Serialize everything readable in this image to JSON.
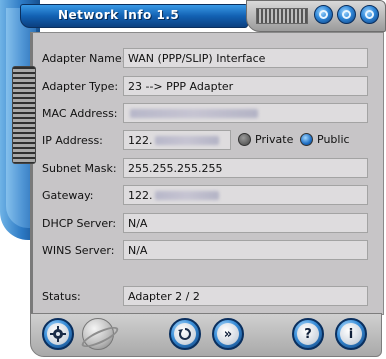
{
  "window": {
    "title": "Network Info 1.5"
  },
  "fields": {
    "adapter_name": {
      "label": "Adapter Name:",
      "value": "WAN (PPP/SLIP) Interface"
    },
    "adapter_type": {
      "label": "Adapter Type:",
      "value": "23  -->  PPP Adapter"
    },
    "mac_address": {
      "label": "MAC Address:",
      "value": ""
    },
    "ip_address": {
      "label": "IP Address:",
      "value": "122."
    },
    "subnet_mask": {
      "label": "Subnet Mask:",
      "value": "255.255.255.255"
    },
    "gateway": {
      "label": "Gateway:",
      "value": "122."
    },
    "dhcp_server": {
      "label": "DHCP Server:",
      "value": "N/A"
    },
    "wins_server": {
      "label": "WINS Server:",
      "value": "N/A"
    },
    "status": {
      "label": "Status:",
      "value": "Adapter 2 / 2"
    }
  },
  "ip_scope": {
    "private_label": "Private",
    "public_label": "Public",
    "selected": "public"
  },
  "toolbar": {
    "help_label": "?",
    "info_label": "i",
    "next_label": "»"
  },
  "colors": {
    "accent": "#1f6fc4",
    "panel": "#c7c5c7",
    "field": "#dedcde"
  }
}
